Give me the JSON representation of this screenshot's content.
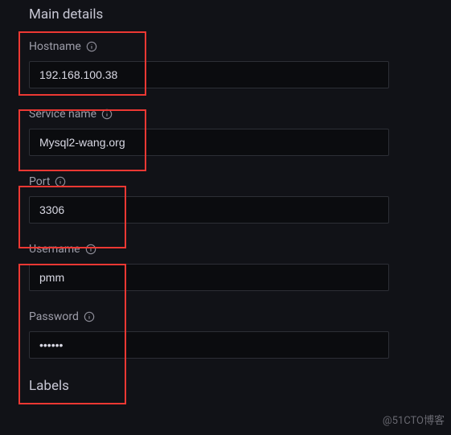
{
  "section": {
    "title": "Main details",
    "next_section": "Labels"
  },
  "fields": {
    "hostname": {
      "label": "Hostname",
      "value": "192.168.100.38"
    },
    "service_name": {
      "label": "Service name",
      "value": "Mysql2-wang.org"
    },
    "port": {
      "label": "Port",
      "value": "3306"
    },
    "username": {
      "label": "Username",
      "value": "pmm"
    },
    "password": {
      "label": "Password",
      "value": "••••••"
    }
  },
  "watermark": "@51CTO博客"
}
